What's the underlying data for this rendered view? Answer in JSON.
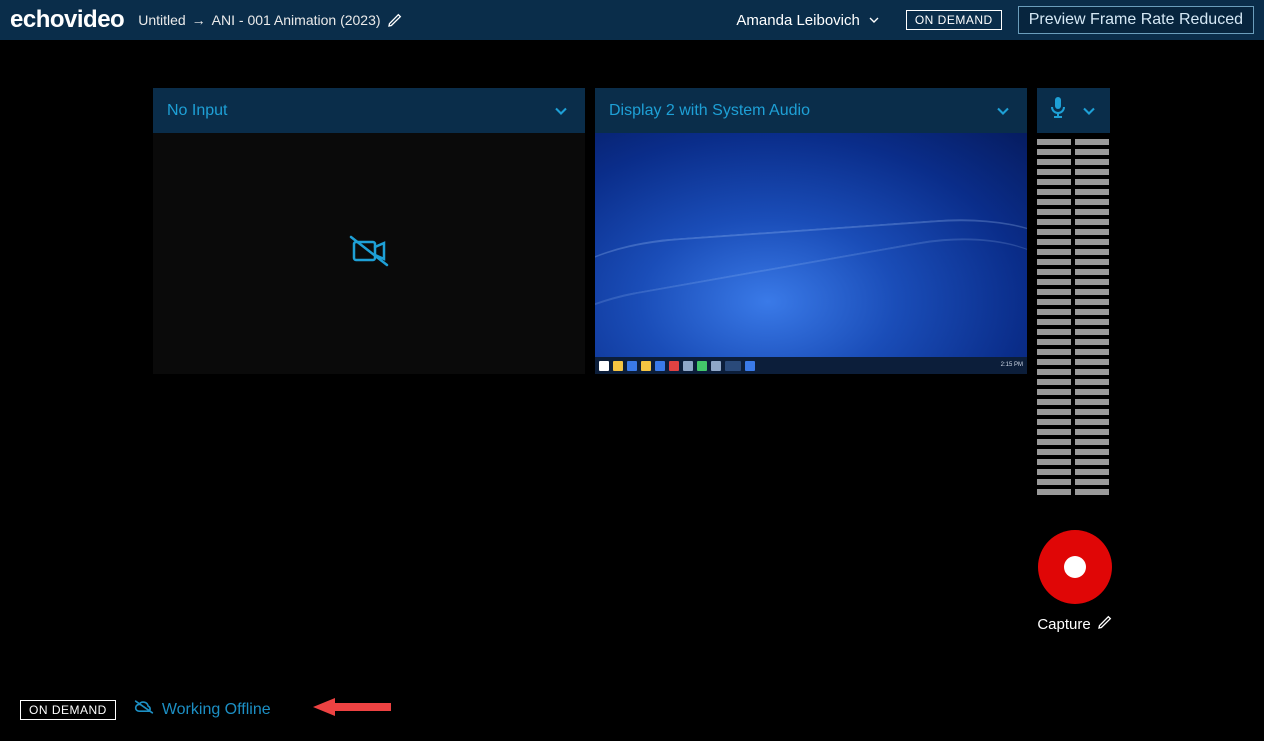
{
  "brand": "echovideo",
  "header": {
    "title_from": "Untitled",
    "arrow": "→",
    "title_to": "ANI - 001 Animation (2023)",
    "user": "Amanda Leibovich",
    "ondemand_badge": "ON DEMAND",
    "framerate_notice": "Preview Frame Rate Reduced"
  },
  "panels": {
    "left": {
      "title": "No Input"
    },
    "right": {
      "title": "Display 2 with System Audio"
    }
  },
  "taskbar_time": "2:15 PM",
  "capture": {
    "label": "Capture"
  },
  "footer": {
    "badge": "ON DEMAND",
    "offline": "Working Offline"
  },
  "colors": {
    "accent": "#1ea0d6",
    "header_bg": "#0a2d4a",
    "record": "#e00606"
  }
}
